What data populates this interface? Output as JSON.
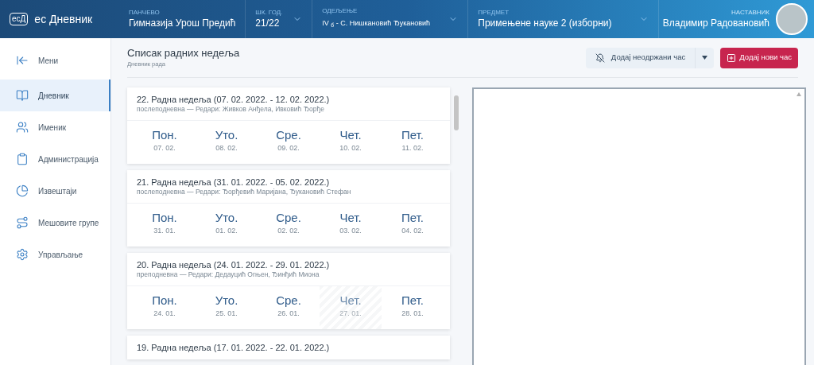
{
  "header": {
    "logo_mark": "есД",
    "app_name": "ес Дневник",
    "fields": [
      {
        "label": "ПАНЧЕВО",
        "value": "Гимназија Урош Предић",
        "dropdown": false
      },
      {
        "label": "ШК. ГОД.",
        "value": "21/22",
        "dropdown": true
      },
      {
        "label": "ОДЕЉЕЊЕ",
        "value": "IV $_{б}$ - С. Нишкановић Ђукановић",
        "dropdown": true
      },
      {
        "label": "ПРЕДМЕТ",
        "value": "Примењене науке 2 (изборни)",
        "dropdown": true
      }
    ],
    "teacher": {
      "label": "НАСТАВНИК",
      "name": "Владимир Радовановић"
    }
  },
  "sidebar": {
    "items": [
      {
        "kind": "back",
        "label": "Мени",
        "selected": false
      },
      {
        "kind": "book",
        "label": "Дневник",
        "selected": true
      },
      {
        "kind": "people",
        "label": "Именик",
        "selected": false
      },
      {
        "kind": "clipboard",
        "label": "Администрација",
        "selected": false
      },
      {
        "kind": "chart",
        "label": "Извештаји",
        "selected": false
      },
      {
        "kind": "branch",
        "label": "Мешовите групе",
        "selected": false
      },
      {
        "kind": "gear",
        "label": "Управљање",
        "selected": false
      }
    ]
  },
  "page": {
    "title": "Списак радних недеља",
    "subtitle": "Дневник рада",
    "buttons": [
      {
        "kind": "secondary",
        "label": "Додај неодржани час"
      },
      {
        "kind": "primary",
        "label": "Додај нови час"
      }
    ]
  },
  "weeks": [
    {
      "title": "22. Радна недеља (07. 02. 2022. - 12. 02. 2022.)",
      "subtitle": "послеподневна — Редари: Живков Анђела, Ивковић Ђорђе",
      "days": [
        {
          "name": "Пон.",
          "date": "07. 02.",
          "unavailable": false
        },
        {
          "name": "Уто.",
          "date": "08. 02.",
          "unavailable": false
        },
        {
          "name": "Сре.",
          "date": "09. 02.",
          "unavailable": false
        },
        {
          "name": "Чет.",
          "date": "10. 02.",
          "unavailable": false
        },
        {
          "name": "Пет.",
          "date": "11. 02.",
          "unavailable": false
        }
      ]
    },
    {
      "title": "21. Радна недеља (31. 01. 2022. - 05. 02. 2022.)",
      "subtitle": "послеподневна — Редари: Ђорђевић Маријана, Ђукановић Стефан",
      "days": [
        {
          "name": "Пон.",
          "date": "31. 01.",
          "unavailable": false
        },
        {
          "name": "Уто.",
          "date": "01. 02.",
          "unavailable": false
        },
        {
          "name": "Сре.",
          "date": "02. 02.",
          "unavailable": false
        },
        {
          "name": "Чет.",
          "date": "03. 02.",
          "unavailable": false
        },
        {
          "name": "Пет.",
          "date": "04. 02.",
          "unavailable": false
        }
      ]
    },
    {
      "title": "20. Радна недеља (24. 01. 2022. - 29. 01. 2022.)",
      "subtitle": "преподневна — Редари: Дедауцић Огњен, Ђинђић Миона",
      "days": [
        {
          "name": "Пон.",
          "date": "24. 01.",
          "unavailable": false
        },
        {
          "name": "Уто.",
          "date": "25. 01.",
          "unavailable": false
        },
        {
          "name": "Сре.",
          "date": "26. 01.",
          "unavailable": false
        },
        {
          "name": "Чет.",
          "date": "27. 01.",
          "unavailable": true
        },
        {
          "name": "Пет.",
          "date": "28. 01.",
          "unavailable": false
        }
      ]
    },
    {
      "title": "19. Радна недеља (17. 01. 2022. - 22. 01. 2022.)"
    }
  ]
}
